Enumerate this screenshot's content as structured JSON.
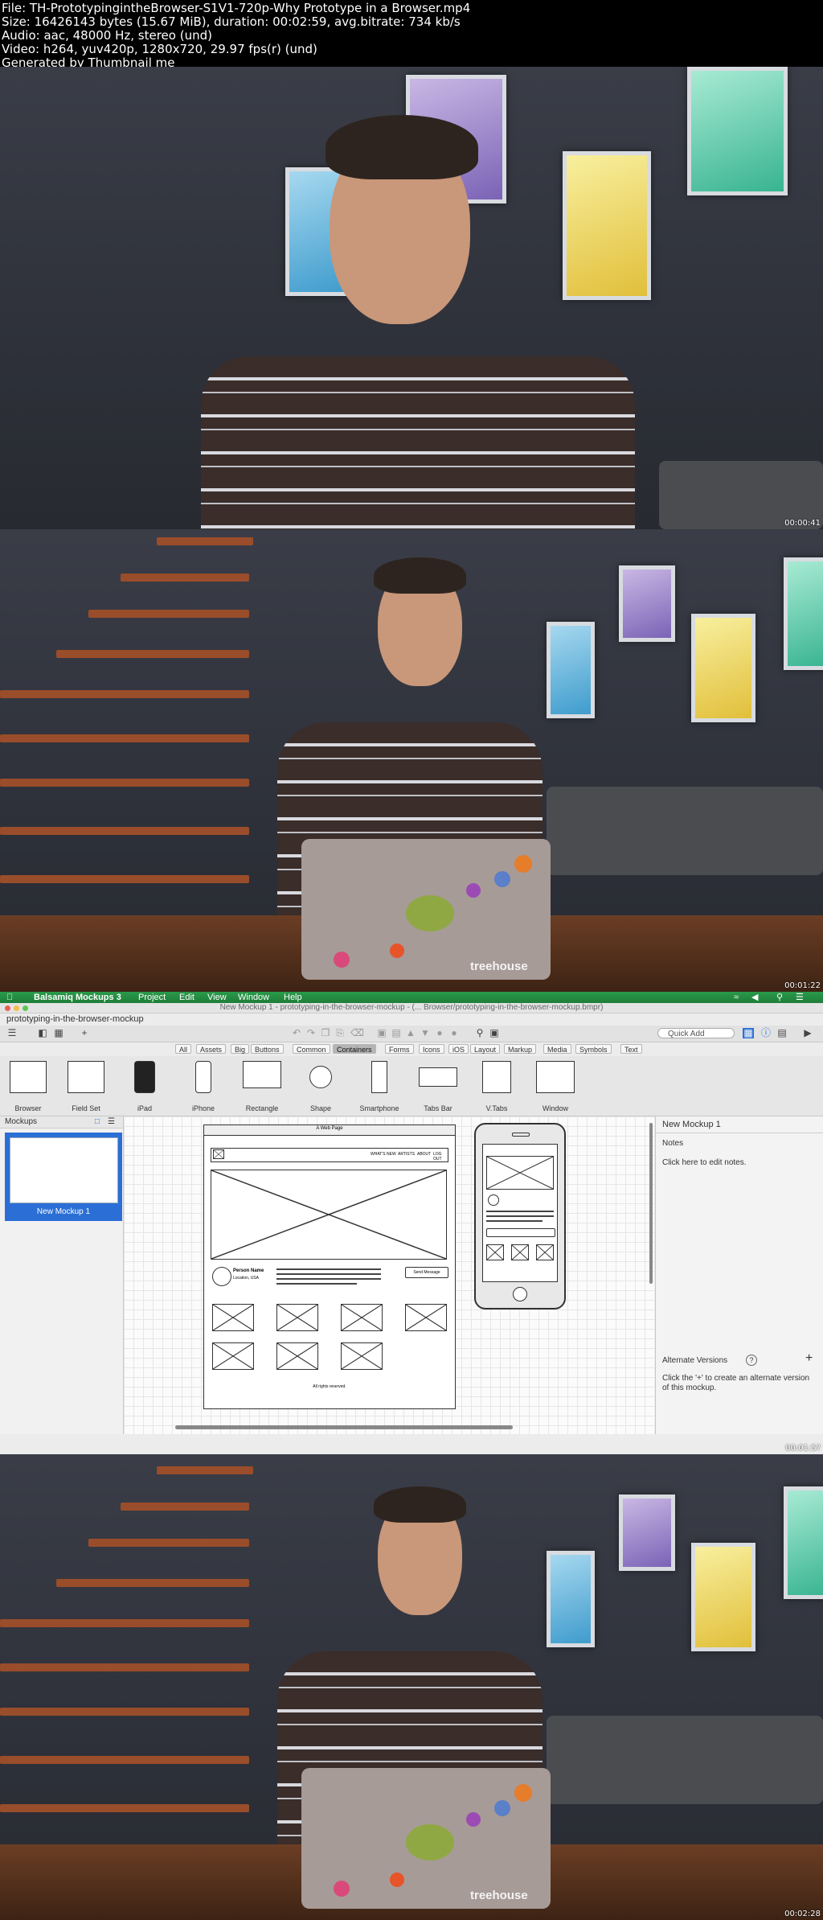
{
  "header": {
    "line1": "File: TH-PrototypingintheBrowser-S1V1-720p-Why Prototype in a Browser.mp4",
    "line2": "Size: 16426143 bytes (15.67 MiB), duration: 00:02:59, avg.bitrate: 734 kb/s",
    "line3": "Audio: aac, 48000 Hz, stereo (und)",
    "line4": "Video: h264, yuv420p, 1280x720, 29.97 fps(r) (und)",
    "line5": "Generated by Thumbnail me"
  },
  "frames": [
    {
      "timestamp": "00:00:41"
    },
    {
      "timestamp": "00:01:22"
    },
    {
      "timestamp": "00:01:5?"
    },
    {
      "timestamp": "00:02:28"
    }
  ],
  "laptop_brand": "treehouse",
  "balsamiq": {
    "app_name": "Balsamiq Mockups 3",
    "menu": [
      "Project",
      "Edit",
      "View",
      "Window",
      "Help"
    ],
    "window_title": "New Mockup 1 - prototyping-in-the-browser-mockup - (... Browser/prototyping-in-the-browser-mockup.bmpr)",
    "project_name": "prototyping-in-the-browser-mockup",
    "quick_add_placeholder": "Quick Add",
    "categories": [
      "All",
      "Assets",
      "Big",
      "Buttons",
      "Common",
      "Containers",
      "Forms",
      "Icons",
      "iOS",
      "Layout",
      "Markup",
      "Media",
      "Symbols",
      "Text"
    ],
    "active_category": "Containers",
    "library": [
      "Browser",
      "Field Set",
      "iPad",
      "iPhone",
      "Rectangle",
      "Shape",
      "Smartphone",
      "Tabs Bar",
      "V.Tabs",
      "Window"
    ],
    "mockups_label": "Mockups",
    "mockup_name": "New Mockup 1",
    "right_title": "New Mockup 1",
    "notes_label": "Notes",
    "notes_hint": "Click here to edit notes.",
    "alt_versions_label": "Alternate Versions",
    "alt_versions_hint": "Click the '+' to create an alternate version of this mockup.",
    "wireframe": {
      "browser_title": "A Web Page",
      "nav": [
        "WHAT'S NEW",
        "ARTISTS",
        "ABOUT",
        "LOG OUT"
      ],
      "person_name": "Person Name",
      "person_location": "Location, USA",
      "send_button": "Send Message",
      "footer": "All rights reserved."
    }
  }
}
